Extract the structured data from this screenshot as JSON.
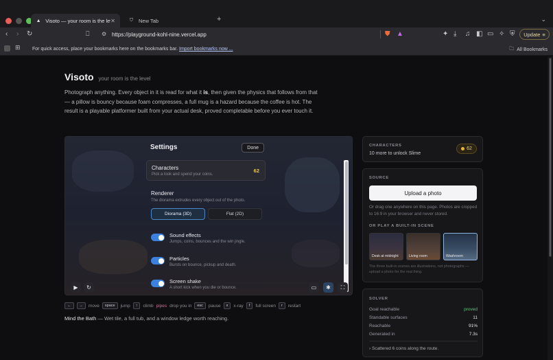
{
  "browser": {
    "tabs": [
      {
        "title": "Visoto — your room is the level",
        "active": true
      },
      {
        "title": "New Tab",
        "active": false
      }
    ],
    "url": "https://playground-kohl-nine.vercel.app",
    "update_label": "Update",
    "bookmarks_msg": "For quick access, place your bookmarks here on the bookmarks bar.",
    "bookmarks_link": "Import bookmarks now ...",
    "all_bookmarks": "All Bookmarks"
  },
  "page": {
    "title": "Visoto",
    "tagline": "your room is the level",
    "intro_a": "Photograph anything. Every object in it is read for what it ",
    "intro_is": "is",
    "intro_b": ", then given the physics that follows from that — a pillow is bouncy because foam compresses, a full mug is a hazard because the coffee is hot. The result is a playable platformer built from your actual desk, proved completable before you ever touch it."
  },
  "settings": {
    "title": "Settings",
    "done_label": "Done",
    "characters": {
      "title": "Characters",
      "subtitle": "Pick a look and spend your coins.",
      "value": "62"
    },
    "renderer": {
      "title": "Renderer",
      "subtitle": "The diorama extrudes every object out of the photo.",
      "options": [
        "Diorama (3D)",
        "Flat (2D)"
      ],
      "selected": "Diorama (3D)"
    },
    "toggles": [
      {
        "title": "Sound effects",
        "subtitle": "Jumps, coins, bounces and the win jingle.",
        "on": true
      },
      {
        "title": "Particles",
        "subtitle": "Bursts on bounce, pickup and death.",
        "on": true
      },
      {
        "title": "Screen shake",
        "subtitle": "A short kick when you die or bounce.",
        "on": true
      }
    ]
  },
  "hints": {
    "left": "←",
    "right": "→",
    "move": "move",
    "space": "space",
    "jump": "jump",
    "up": "↑",
    "climb": "climb",
    "pipes": "pipes",
    "drop": "drop you in",
    "esc": "esc",
    "pause": "pause",
    "x": "x",
    "xray": "x-ray",
    "f": "f",
    "fullscreen": "full screen",
    "r": "r",
    "restart": "restart"
  },
  "scene_caption": {
    "name": "Mind the Bath",
    "text": " — Wet tile, a full tub, and a window ledge worth reaching."
  },
  "characters_panel": {
    "label": "CHARACTERS",
    "text": "10 more to unlock Slime",
    "coins": "62"
  },
  "source_panel": {
    "label": "SOURCE",
    "upload_label": "Upload a photo",
    "drag_text": "Or drag one anywhere on this page. Photos are cropped to 16:9 in your browser and never stored.",
    "scenes_label": "OR PLAY A BUILT-IN SCENE",
    "scenes": [
      "Desk at midnight",
      "Living room",
      "Washroom"
    ],
    "selected_scene": "Washroom",
    "note": "The three built-in scenes are illustrations, not photographs — upload a photo for the real thing."
  },
  "solver_panel": {
    "label": "SOLVER",
    "rows": [
      {
        "k": "Goal reachable",
        "v": "proved"
      },
      {
        "k": "Standable surfaces",
        "v": "11"
      },
      {
        "k": "Reachable",
        "v": "91%"
      },
      {
        "k": "Generated in",
        "v": "7.3s"
      }
    ],
    "footer": "Scattered 6 coins along the route."
  }
}
